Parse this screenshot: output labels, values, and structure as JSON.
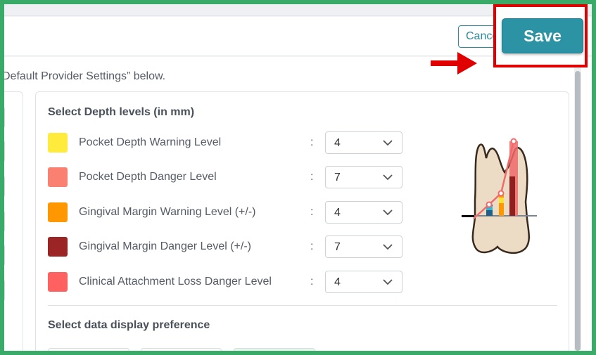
{
  "header": {
    "cancel_label": "Cancel",
    "save_label": "Save"
  },
  "intro_text": "Default Provider Settings” below.",
  "depth_section": {
    "title": "Select Depth levels (in mm)",
    "rows": [
      {
        "label": "Pocket Depth Warning Level",
        "value": "4",
        "color": "#ffeb3b"
      },
      {
        "label": "Pocket Depth Danger Level",
        "value": "7",
        "color": "#fa8072"
      },
      {
        "label": "Gingival Margin Warning Level (+/-)",
        "value": "4",
        "color": "#ff9800"
      },
      {
        "label": "Gingival Margin Danger Level (+/-)",
        "value": "7",
        "color": "#9b2424"
      },
      {
        "label": "Clinical Attachment Loss Danger Level",
        "value": "4",
        "color": "#ff6060"
      }
    ],
    "separator": ":"
  },
  "display_section": {
    "title": "Select data display preference"
  },
  "colors": {
    "accent": "#2b93a4",
    "highlight": "#e00000",
    "frame": "#3aaa68"
  }
}
